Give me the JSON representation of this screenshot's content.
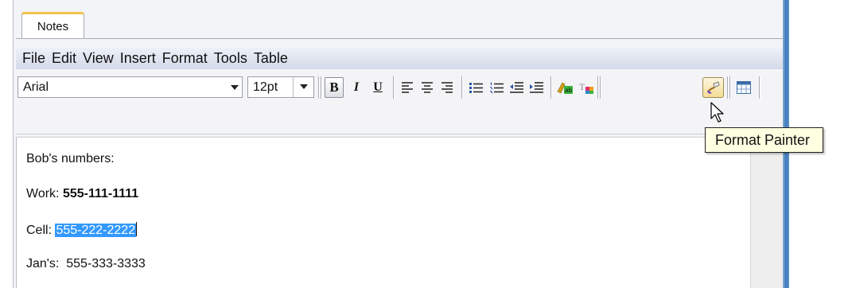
{
  "tab": {
    "label": "Notes"
  },
  "menu": [
    "File",
    "Edit",
    "View",
    "Insert",
    "Format",
    "Tools",
    "Table"
  ],
  "toolbar": {
    "font": "Arial",
    "size": "12pt",
    "bold_label": "B",
    "italic_label": "I",
    "underline_label": "U",
    "icons": [
      "align-left-icon",
      "align-center-icon",
      "align-right-icon",
      "bulleted-list-icon",
      "numbered-list-icon",
      "decrease-indent-icon",
      "increase-indent-icon",
      "text-highlight-color-icon",
      "text-color-icon",
      "format-painter-icon",
      "insert-table-icon"
    ]
  },
  "tooltip": "Format Painter",
  "document": {
    "line1": "Bob's numbers:",
    "line2_label": "Work: ",
    "line2_value": "555-111-1111",
    "line3_label": "Cell: ",
    "line3_selected": "555-222-2222",
    "line4": "Jan's:  555-333-3333"
  },
  "colors": {
    "tab_accent": "#f1c34a",
    "selection": "#3399ff",
    "tooltip_bg": "#ffffe1",
    "window_border": "#3f7bbd"
  }
}
